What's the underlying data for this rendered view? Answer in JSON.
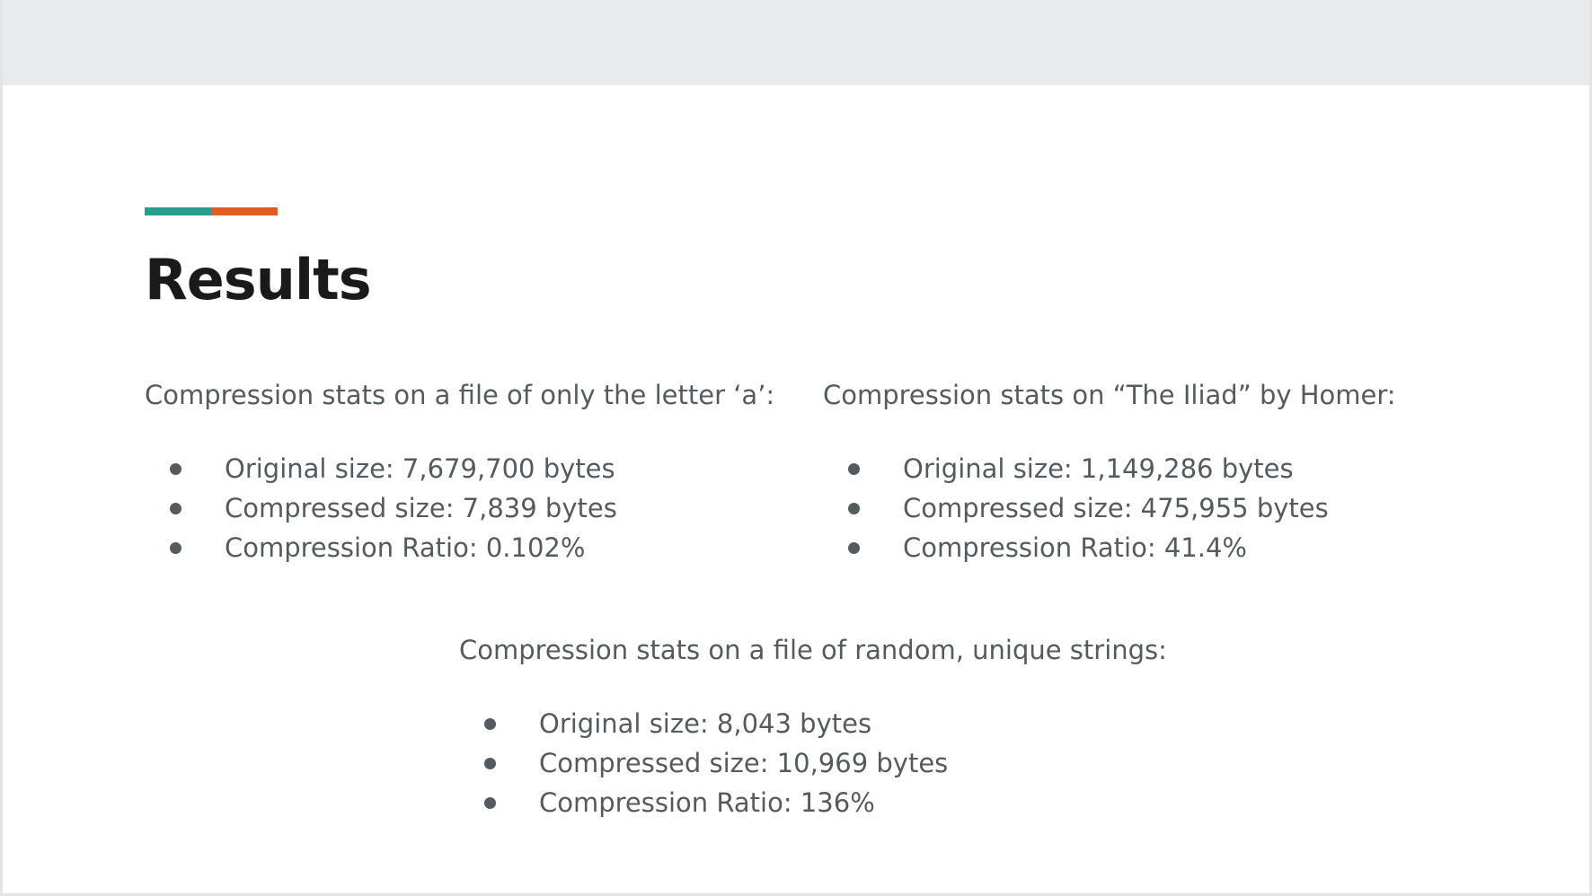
{
  "slide": {
    "title": "Results",
    "accent_colors": [
      "#2a9d8f",
      "#e35b24"
    ]
  },
  "blocks": {
    "a": {
      "heading": "Compression stats on a file of only the letter  ‘a’:",
      "items": [
        "Original size: 7,679,700 bytes",
        "Compressed size: 7,839 bytes",
        "Compression Ratio:  0.102%"
      ]
    },
    "b": {
      "heading": "Compression stats on “The Iliad”  by Homer:",
      "items": [
        "Original size: 1,149,286 bytes",
        "Compressed size: 475,955 bytes",
        "Compression Ratio: 41.4%"
      ]
    },
    "c": {
      "heading": "Compression stats on a file of random, unique strings:",
      "items": [
        "Original size: 8,043 bytes",
        "Compressed size: 10,969 bytes",
        "Compression Ratio: 136%"
      ]
    }
  }
}
